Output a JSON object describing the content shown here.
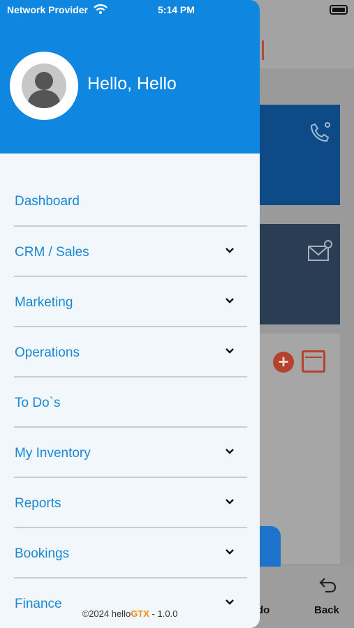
{
  "status_bar": {
    "carrier": "Network Provider",
    "time": "5:14 PM"
  },
  "header": {
    "greeting": "Hello, Hello"
  },
  "menu": {
    "items": [
      {
        "label": "Dashboard",
        "expandable": false
      },
      {
        "label": "CRM / Sales",
        "expandable": true
      },
      {
        "label": "Marketing",
        "expandable": true
      },
      {
        "label": "Operations",
        "expandable": true
      },
      {
        "label": "To Do`s",
        "expandable": false
      },
      {
        "label": "My Inventory",
        "expandable": true
      },
      {
        "label": "Reports",
        "expandable": true
      },
      {
        "label": "Bookings",
        "expandable": true
      },
      {
        "label": "Finance",
        "expandable": true
      }
    ]
  },
  "footer": {
    "prefix": "©2024 hello",
    "brand": "GTX",
    "suffix": " - 1.0.0"
  },
  "background": {
    "todo_label": "do",
    "back_label": "Back"
  },
  "colors": {
    "header": "#0f86df",
    "menu_text": "#1a87d6",
    "brand_accent": "#f08a1c"
  },
  "icons": [
    "wifi-icon",
    "battery-icon",
    "avatar-icon",
    "chevron-down-icon",
    "phone-icon",
    "mail-icon",
    "plus-icon",
    "calendar-icon",
    "back-icon"
  ]
}
